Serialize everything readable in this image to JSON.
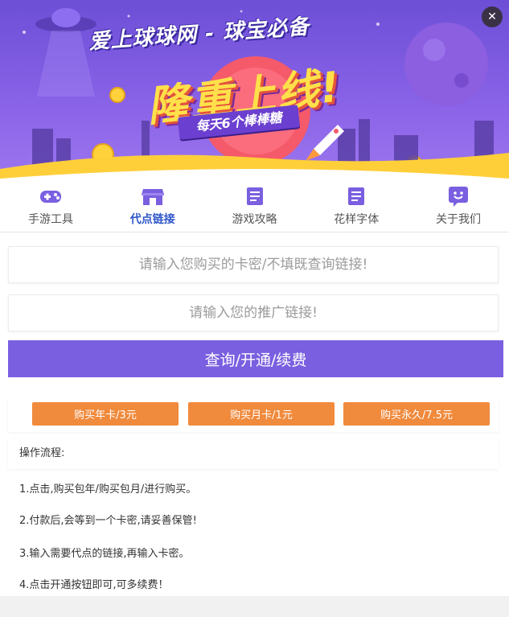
{
  "banner": {
    "title": "爱上球球网 - 球宝必备",
    "headline": "隆重上线!",
    "ribbon": "每天6个棒棒糖",
    "close_symbol": "✕"
  },
  "nav": {
    "items": [
      {
        "label": "手游工具",
        "icon": "gamepad-icon"
      },
      {
        "label": "代点链接",
        "icon": "store-icon",
        "active": true
      },
      {
        "label": "游戏攻略",
        "icon": "document-icon"
      },
      {
        "label": "花样字体",
        "icon": "document-icon"
      },
      {
        "label": "关于我们",
        "icon": "smiley-icon"
      }
    ]
  },
  "form": {
    "card_placeholder": "请输入您购买的卡密/不填既查询链接!",
    "link_placeholder": "请输入您的推广链接!",
    "submit_label": "查询/开通/续费"
  },
  "buy": {
    "year_label": "购买年卡/3元",
    "month_label": "购买月卡/1元",
    "forever_label": "购买永久/7.5元"
  },
  "process": {
    "title": "操作流程:",
    "steps": [
      "1.点击,购买包年/购买包月/进行购买。",
      "2.付款后,会等到一个卡密,请妥善保管!",
      "3.输入需要代点的链接,再输入卡密。",
      "4.点击开通按钮即可,可多续费！"
    ]
  },
  "colors": {
    "accent_purple": "#7a5fe0",
    "nav_active": "#2e56c8",
    "buy_orange": "#f08a3c",
    "icon_purple": "#7a5fe0"
  }
}
